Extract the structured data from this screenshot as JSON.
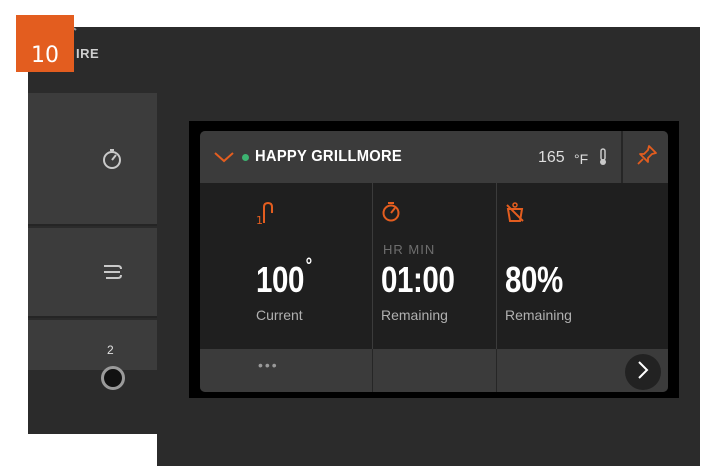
{
  "step": {
    "number": "10"
  },
  "brand": {
    "partial_text": "IRE",
    "icon": "wifi-signal-icon"
  },
  "sidebar": {
    "items": [
      {
        "name": "timer",
        "icon": "stopwatch-icon"
      },
      {
        "name": "smoke",
        "icon": "smoke-icon"
      },
      {
        "name": "probe",
        "icon": "probe-jack-icon",
        "count": "2"
      }
    ]
  },
  "grill": {
    "name": "HAPPY GRILLMORE",
    "status_color": "#3cb371",
    "temperature": "165",
    "temp_unit": "°F"
  },
  "stats": [
    {
      "icon": "probe-icon",
      "value": "100",
      "unit": "°",
      "label": "Current"
    },
    {
      "icon": "stopwatch-icon",
      "header": "HR  MIN",
      "value": "01:00",
      "label": "Remaining"
    },
    {
      "icon": "pellet-level-icon",
      "value": "80%",
      "label": "Remaining"
    }
  ],
  "footer": {
    "more": "•••"
  },
  "colors": {
    "accent": "#e35d1f",
    "background": "#2b2b2b",
    "card": "#1f1f1f",
    "header": "#3b3b3b"
  }
}
